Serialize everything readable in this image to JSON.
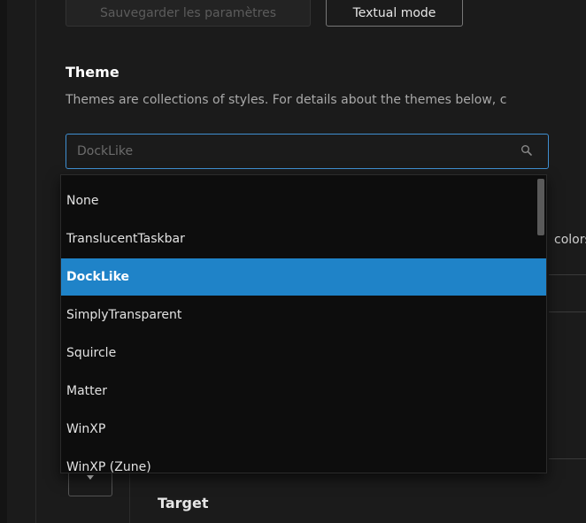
{
  "settings": {
    "save_button_label": "Sauvegarder les paramètres",
    "mode_button_label": "Textual mode"
  },
  "theme": {
    "heading": "Theme",
    "description": "Themes are collections of styles. For details about the themes below, c",
    "search_value": "",
    "search_placeholder": "DockLike",
    "dropdown_options": [
      "None",
      "TranslucentTaskbar",
      "DockLike",
      "SimplyTransparent",
      "Squircle",
      "Matter",
      "WinXP",
      "WinXP (Zune)"
    ],
    "selected_option": "DockLike"
  },
  "background": {
    "partial_text": "colors",
    "target_label": "Target"
  },
  "colors": {
    "accent": "#1f83c8",
    "focus_border": "#3f8fd1",
    "background": "#1b1b1b",
    "dropdown_background": "#0d0d0d"
  },
  "icons": {
    "search": "search-icon",
    "collapse": "chevron-down-icon"
  }
}
